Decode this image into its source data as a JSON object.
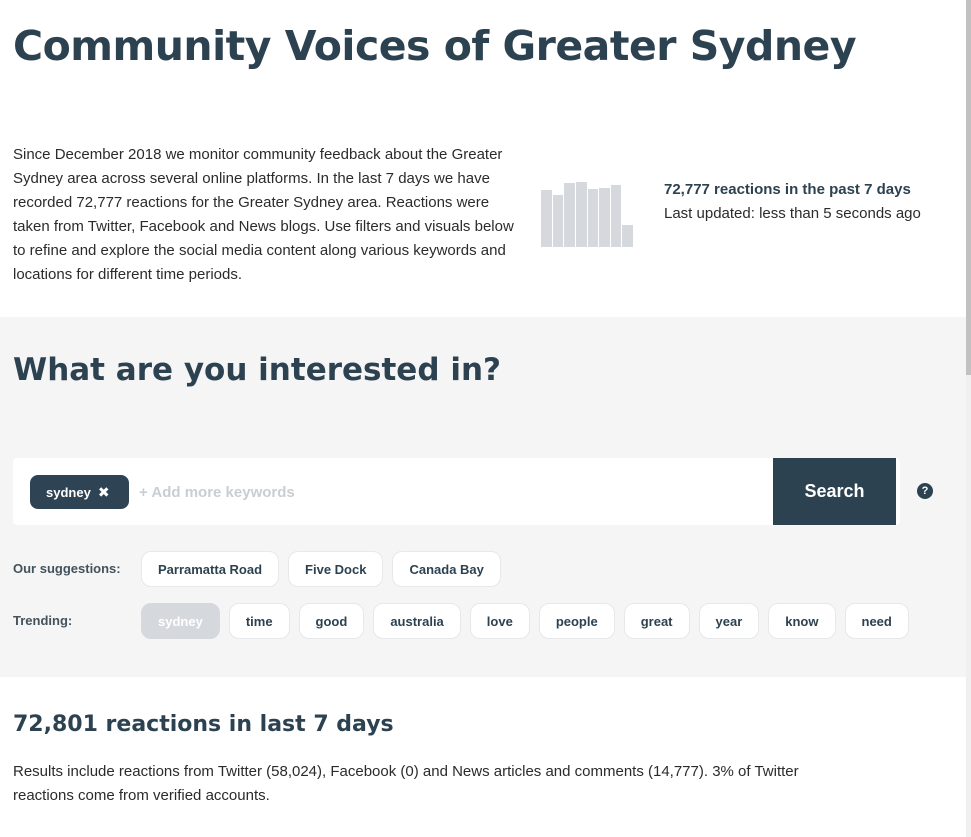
{
  "header": {
    "title": "Community Voices of Greater Sydney"
  },
  "intro": {
    "text": "Since December 2018 we monitor community feedback about the Greater Sydney area across several online platforms. In the last 7 days we have recorded 72,777 reactions for the Greater Sydney area. Reactions were taken from Twitter, Facebook and News blogs. Use filters and visuals below to refine and explore the social media content along various keywords and locations for different time periods."
  },
  "mini_chart": {
    "values": [
      0.84,
      0.76,
      0.94,
      0.96,
      0.85,
      0.87,
      0.91,
      0.32
    ],
    "color": "#d5d9dd"
  },
  "stats": {
    "headline": "72,777 reactions in the past 7 days",
    "updated": "Last updated: less than 5 seconds ago"
  },
  "filters": {
    "title": "What are you interested in?",
    "keyword_chip": "sydney",
    "remove_icon": "close-icon",
    "input_placeholder": "+ Add more keywords",
    "search_label": "Search",
    "help_icon": "?",
    "suggestions_label": "Our suggestions:",
    "suggestions": [
      "Parramatta Road",
      "Five Dock",
      "Canada Bay"
    ],
    "trending_label": "Trending:",
    "trending": [
      "sydney",
      "time",
      "good",
      "australia",
      "love",
      "people",
      "great",
      "year",
      "know",
      "need"
    ],
    "trending_active": "sydney"
  },
  "results": {
    "title": "72,801 reactions in last 7 days",
    "description": "Results include reactions from Twitter (58,024), Facebook (0) and News articles and comments (14,777). 3% of Twitter reactions come from verified accounts."
  },
  "colors": {
    "primary": "#2d4251",
    "section_bg": "#f4f5f4",
    "muted": "#d5d9dd"
  }
}
